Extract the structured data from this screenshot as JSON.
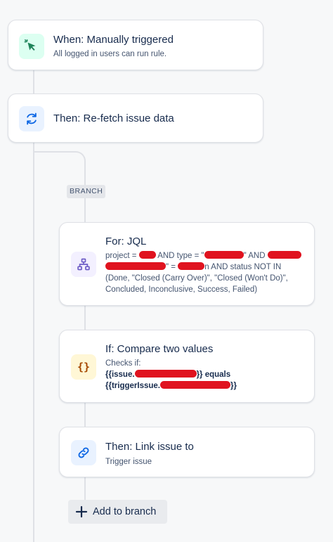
{
  "trigger": {
    "title": "When: Manually triggered",
    "subtitle": "All logged in users can run rule.",
    "icon": "cursor-click-icon",
    "icon_color": "#1f845a",
    "icon_bg": "#dcfff1"
  },
  "refetch": {
    "title": "Then: Re-fetch issue data",
    "icon": "refresh-icon",
    "icon_color": "#0c66e4",
    "icon_bg": "#e9f2ff"
  },
  "branch": {
    "badge": "BRANCH"
  },
  "for_jql": {
    "title": "For: JQL",
    "line1_a": "project = ",
    "line1_b": "AND type = \"",
    "line1_c": "\" AND",
    "line2_a": "\" = ",
    "line2_b": "n AND status NOT IN",
    "line3": "(Done, \"Closed (Carry Over)\", \"Closed (Won't Do)\",",
    "line4": "Concluded, Inconclusive, Success, Failed)",
    "icon": "hierarchy-icon",
    "icon_color": "#6e5dc6",
    "icon_bg": "#f3f0ff"
  },
  "compare": {
    "title": "If: Compare two values",
    "checks_label": "Checks if:",
    "line1_a": "{{issue.",
    "line1_b": "}} equals",
    "line2_a": "{{triggerIssue.",
    "line2_b": "}}",
    "icon": "curly-braces-icon",
    "icon_color": "#a54800",
    "icon_bg": "#fff7d6"
  },
  "link": {
    "title": "Then: Link issue to",
    "subtitle": "Trigger issue",
    "icon": "link-icon",
    "icon_color": "#0c66e4",
    "icon_bg": "#e9f2ff"
  },
  "add_branch": {
    "label": "Add to branch",
    "icon": "plus-icon"
  },
  "colors": {
    "redaction": "#e0131f",
    "connector": "#dfe1e6"
  }
}
